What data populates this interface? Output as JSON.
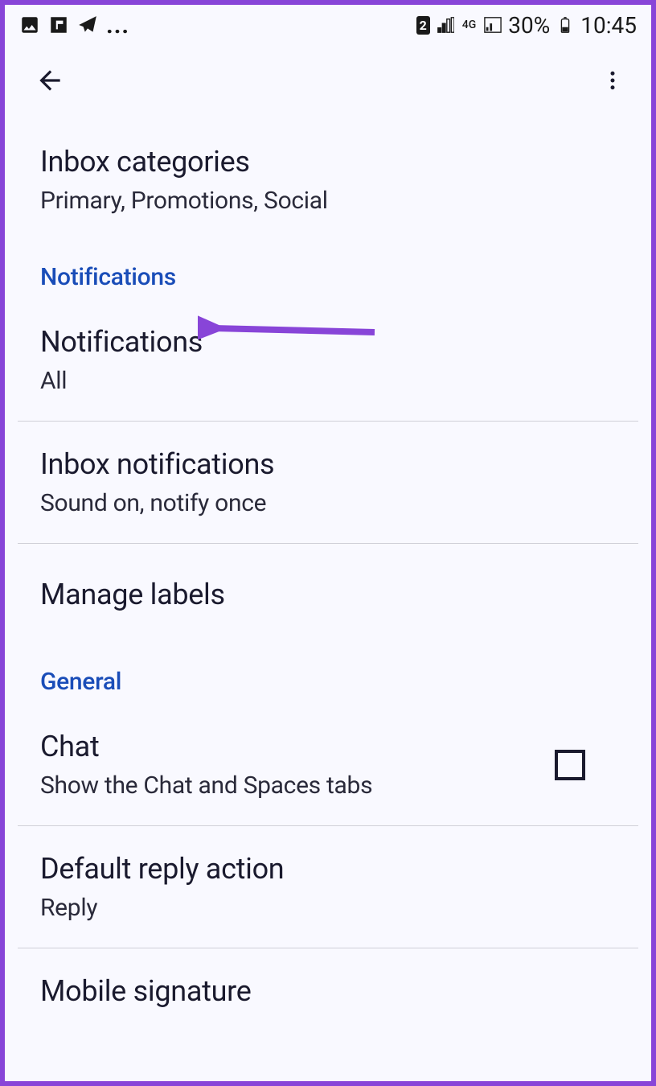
{
  "status_bar": {
    "sim_badge": "2",
    "network_label": "4G",
    "battery_percent": "30%",
    "time": "10:45"
  },
  "settings": {
    "inbox_categories": {
      "title": "Inbox categories",
      "subtitle": "Primary, Promotions, Social"
    },
    "sections": {
      "notifications_header": "Notifications",
      "general_header": "General"
    },
    "notifications": {
      "title": "Notifications",
      "value": "All"
    },
    "inbox_notifications": {
      "title": "Inbox notifications",
      "value": "Sound on, notify once"
    },
    "manage_labels": {
      "title": "Manage labels"
    },
    "chat": {
      "title": "Chat",
      "subtitle": "Show the Chat and Spaces tabs",
      "checked": false
    },
    "default_reply": {
      "title": "Default reply action",
      "value": "Reply"
    },
    "mobile_signature": {
      "title": "Mobile signature"
    }
  }
}
